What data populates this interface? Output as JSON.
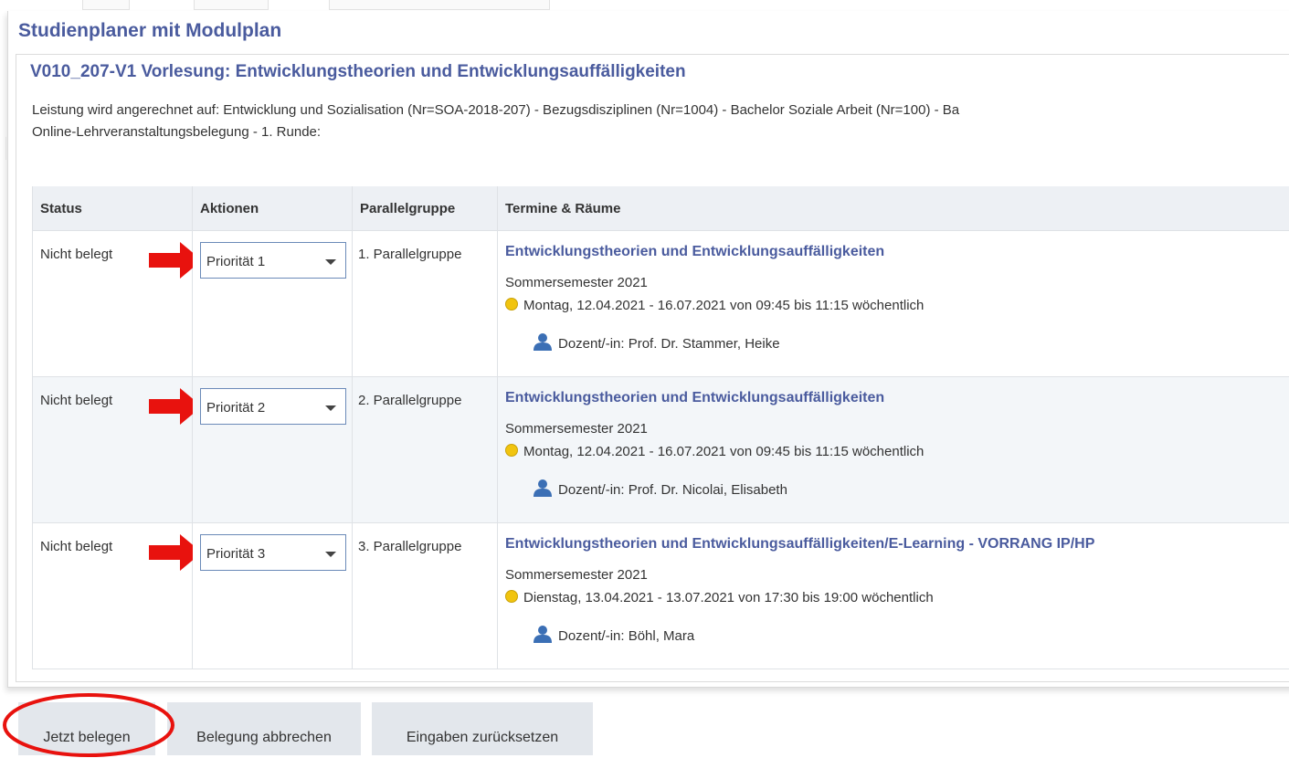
{
  "page": {
    "title": "Studienplaner mit Modulplan"
  },
  "course": {
    "title": "V010_207-V1 Vorlesung: Entwicklungstheorien und Entwicklungsauffälligkeiten",
    "credit_text": "Leistung wird angerechnet auf: Entwicklung und Sozialisation (Nr=SOA-2018-207) - Bezugsdisziplinen (Nr=1004) - Bachelor Soziale Arbeit (Nr=100) - Ba",
    "round_text": "Online-Lehrveranstaltungsbelegung - 1. Runde:"
  },
  "table": {
    "headers": {
      "status": "Status",
      "actions": "Aktionen",
      "group": "Parallelgruppe",
      "dates": "Termine & Räume"
    },
    "rows": [
      {
        "status": "Nicht belegt",
        "priority": "Priorität 1",
        "group": "1. Parallelgruppe",
        "event": "Entwicklungstheorien und Entwicklungsauffälligkeiten",
        "semester": "Sommersemester 2021",
        "schedule": "Montag, 12.04.2021 - 16.07.2021 von 09:45 bis 11:15 wöchentlich",
        "lecturer": "Dozent/-in: Prof. Dr. Stammer, Heike"
      },
      {
        "status": "Nicht belegt",
        "priority": "Priorität 2",
        "group": "2. Parallelgruppe",
        "event": "Entwicklungstheorien und Entwicklungsauffälligkeiten",
        "semester": "Sommersemester 2021",
        "schedule": "Montag, 12.04.2021 - 16.07.2021 von 09:45 bis 11:15 wöchentlich",
        "lecturer": "Dozent/-in: Prof. Dr. Nicolai, Elisabeth"
      },
      {
        "status": "Nicht belegt",
        "priority": "Priorität 3",
        "group": "3. Parallelgruppe",
        "event": "Entwicklungstheorien und Entwicklungsauffälligkeiten/E-Learning - VORRANG IP/HP",
        "semester": "Sommersemester 2021",
        "schedule": "Dienstag, 13.04.2021 - 13.07.2021 von 17:30 bis 19:00 wöchentlich",
        "lecturer": "Dozent/-in: Böhl, Mara"
      }
    ]
  },
  "buttons": {
    "submit": "Jetzt belegen",
    "cancel": "Belegung abbrechen",
    "reset": "Eingaben zurücksetzen"
  },
  "icons": {
    "status_dot": "yellow-dot-icon",
    "lecturer": "person-icon",
    "dropdown": "chevron-down-icon",
    "annotation_arrow": "red-arrow",
    "annotation_ellipse": "red-ellipse"
  },
  "colors": {
    "title": "#4a5b9e",
    "header_bg": "#edf0f4",
    "row_alt_bg": "#f3f6f9",
    "button_bg": "#e3e7ec",
    "dot": "#f1c40f",
    "annotation": "#e8120e"
  }
}
